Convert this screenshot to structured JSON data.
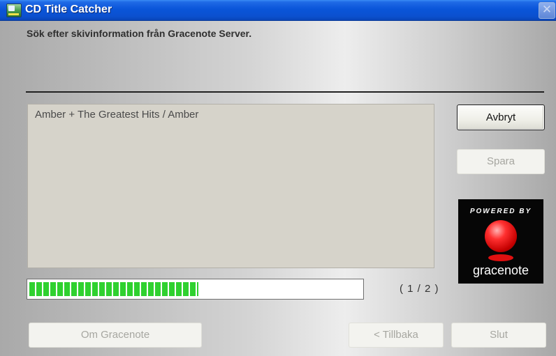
{
  "window": {
    "title": "CD Title Catcher",
    "subtitle": "Sök efter skivinformation från Gracenote Server."
  },
  "results": {
    "items": [
      "Amber + The Greatest Hits / Amber"
    ]
  },
  "buttons": {
    "cancel": "Avbryt",
    "save": "Spara",
    "about_gracenote": "Om Gracenote",
    "back": "< Tillbaka",
    "finish": "Slut"
  },
  "logo": {
    "tagline": "POWERED BY",
    "brand": "gracenote"
  },
  "progress": {
    "fraction": 0.51,
    "counter": "( 1 / 2 )"
  },
  "icons": {
    "app": "cd-title-catcher-icon",
    "close": "close-icon"
  },
  "colors": {
    "titlebar": "#0a55d9",
    "progress_fill": "#2fd12f",
    "logo_accent": "#e01010"
  }
}
